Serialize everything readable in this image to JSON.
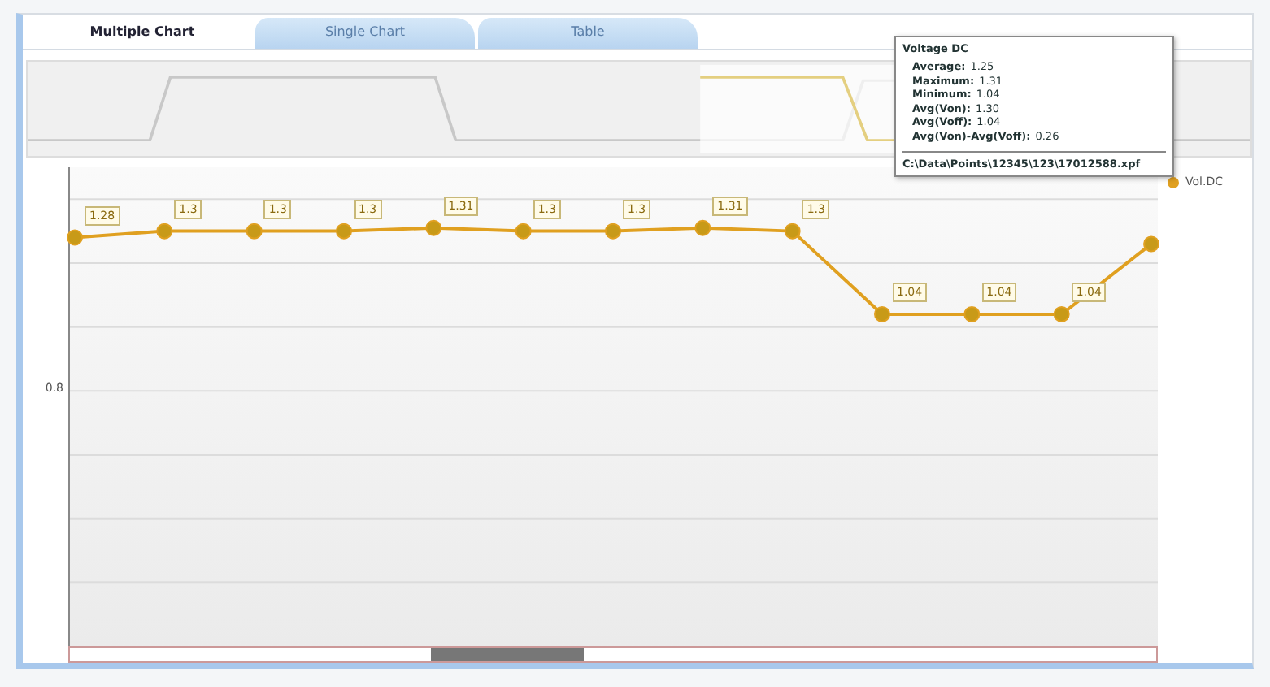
{
  "tabs": [
    {
      "label": "Multiple Chart",
      "selected": true
    },
    {
      "label": "Single Chart",
      "selected": false
    },
    {
      "label": "Table",
      "selected": false
    }
  ],
  "tooltip": {
    "title": "Voltage DC",
    "lines": [
      {
        "label": "Average:",
        "value": "1.25"
      },
      {
        "label": "Maximum:",
        "value": "1.31"
      },
      {
        "label": "Minimum:",
        "value": "1.04"
      },
      {
        "label": "Avg(Von):",
        "value": "1.30"
      },
      {
        "label": "Avg(Voff):",
        "value": "1.04"
      },
      {
        "label": "Avg(Von)-Avg(Voff):",
        "value": "0.26"
      }
    ],
    "path": "C:\\Data\\Points\\12345\\123\\17012588.xpf"
  },
  "chart": {
    "y_axis_label": "0.8",
    "chart_data": {
      "type": "line",
      "ylim": [
        0,
        1.5
      ],
      "series": [
        {
          "name": "Vol.DC",
          "color": "#e0a020",
          "marker": "circle",
          "values": [
            1.28,
            1.3,
            1.3,
            1.3,
            1.31,
            1.3,
            1.3,
            1.31,
            1.3,
            1.04,
            1.04,
            1.04,
            1.26
          ],
          "value_labels": [
            "1.28",
            "1.3",
            "1.3",
            "1.3",
            "1.31",
            "1.3",
            "1.3",
            "1.31",
            "1.3",
            "1.04",
            "1.04",
            "1.04",
            null
          ]
        }
      ]
    }
  }
}
